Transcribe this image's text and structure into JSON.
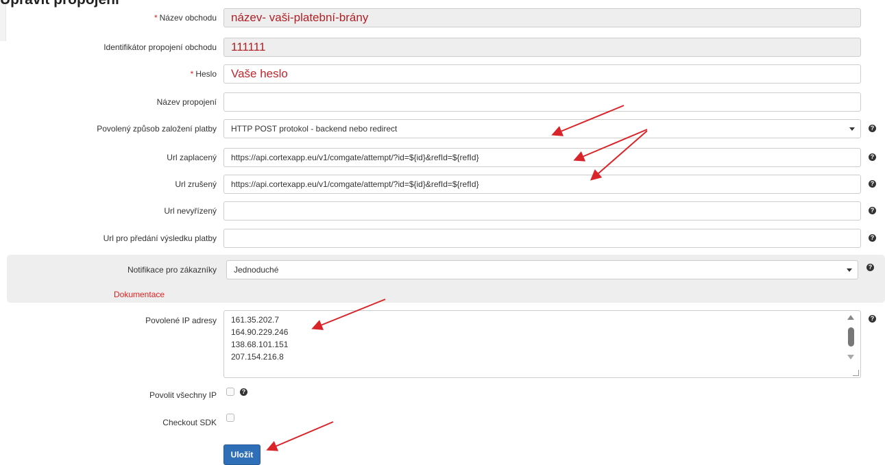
{
  "page": {
    "heading": "Upravit propojení"
  },
  "colors": {
    "accent": "#2f6fb7",
    "required": "#e02020",
    "annotation_arrow": "#d9252a"
  },
  "form": {
    "required_mark": "*",
    "shop_name": {
      "label": "Název obchodu",
      "value": "název- vaši-platební-brány"
    },
    "shop_id": {
      "label": "Identifikátor propojení obchodu",
      "value": "111111"
    },
    "password": {
      "label": "Heslo",
      "value": "Vaše heslo"
    },
    "connection_name": {
      "label": "Název propojení",
      "value": ""
    },
    "payment_method": {
      "label": "Povolený způsob založení platby",
      "value": "HTTP POST protokol - backend nebo redirect"
    },
    "url_paid": {
      "label": "Url zaplacený",
      "value": "https://api.cortexapp.eu/v1/comgate/attempt/?id=${id}&refId=${refId}"
    },
    "url_cancelled": {
      "label": "Url zrušený",
      "value": "https://api.cortexapp.eu/v1/comgate/attempt/?id=${id}&refId=${refId}"
    },
    "url_pending": {
      "label": "Url nevyřízený",
      "value": ""
    },
    "url_result": {
      "label": "Url pro předání výsledku platby",
      "value": ""
    },
    "notifications": {
      "label": "Notifikace pro zákazníky",
      "value": "Jednoduché"
    },
    "documentation_link": "Dokumentace",
    "allowed_ips": {
      "label": "Povolené IP adresy",
      "values": [
        "161.35.202.7",
        "164.90.229.246",
        "138.68.101.151",
        "207.154.216.8"
      ]
    },
    "allow_all_ips": {
      "label": "Povolit všechny IP",
      "checked": false
    },
    "checkout_sdk": {
      "label": "Checkout SDK",
      "checked": false
    },
    "save_label": "Uložit",
    "help_glyph": "?"
  }
}
